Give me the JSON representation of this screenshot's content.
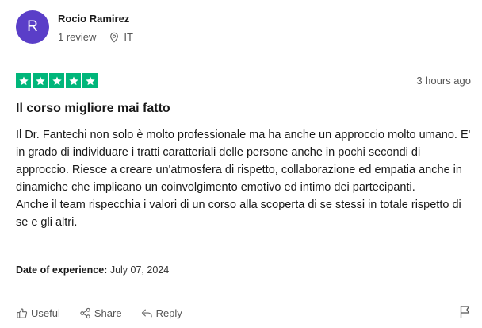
{
  "reviewer": {
    "avatar_letter": "R",
    "name": "Rocio Ramirez",
    "reviews_count": "1 review",
    "country": "IT",
    "avatar_color": "#5a3ec8"
  },
  "review": {
    "rating": 5,
    "star_color": "#00b67a",
    "time_ago": "3 hours ago",
    "title": "Il corso migliore mai fatto",
    "paragraphs": [
      "Il Dr. Fantechi non solo è molto professionale ma ha anche un approccio molto umano. E' in grado di individuare i tratti caratteriali delle persone anche in pochi secondi di approccio. Riesce a creare un'atmosfera di rispetto, collaborazione ed empatia anche in dinamiche che implicano un coinvolgimento emotivo ed intimo dei partecipanti.",
      "Anche il team rispecchia i valori di un corso alla scoperta di se stessi in totale rispetto di se e gli altri."
    ],
    "experience_label": "Date of experience:",
    "experience_date": "July 07, 2024"
  },
  "actions": {
    "useful_label": "Useful",
    "share_label": "Share",
    "reply_label": "Reply"
  }
}
